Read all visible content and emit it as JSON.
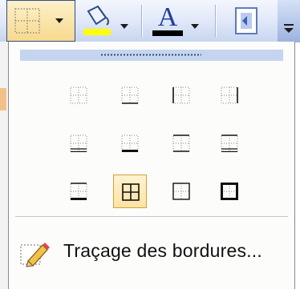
{
  "toolbar": {
    "buttons": [
      {
        "id": "borders",
        "icon": "borders-grid-icon",
        "has_dropdown": true
      },
      {
        "id": "fill-color",
        "icon": "paint-bucket-icon",
        "has_dropdown": true,
        "color": "#ffff00"
      },
      {
        "id": "font-color",
        "icon": "font-color-icon",
        "glyph": "A",
        "has_dropdown": true,
        "color": "#000000"
      },
      {
        "id": "page-setup",
        "icon": "document-icon",
        "has_dropdown": false
      }
    ]
  },
  "border_menu": {
    "options": [
      {
        "name": "no-border",
        "style": "none"
      },
      {
        "name": "bottom-border",
        "style": "bottom"
      },
      {
        "name": "left-border",
        "style": "left"
      },
      {
        "name": "right-border",
        "style": "right"
      },
      {
        "name": "double-bottom-border",
        "style": "double-bottom"
      },
      {
        "name": "thick-bottom-border",
        "style": "thick-bottom"
      },
      {
        "name": "top-bottom-border",
        "style": "top-bottom"
      },
      {
        "name": "top-double-bottom-border",
        "style": "top-double-bottom"
      },
      {
        "name": "top-thick-bottom-border",
        "style": "top-thick-bottom"
      },
      {
        "name": "all-borders",
        "style": "all",
        "selected": true
      },
      {
        "name": "outside-borders",
        "style": "outside"
      },
      {
        "name": "thick-box-border",
        "style": "thick-box"
      }
    ],
    "draw_borders_label": "Traçage des bordures..."
  },
  "colors": {
    "toolbar_bg": "#dfe7f8",
    "selected_bg": "#fde2a4",
    "selected_border": "#d69e3a",
    "drag_handle": "#c5d5f0"
  }
}
